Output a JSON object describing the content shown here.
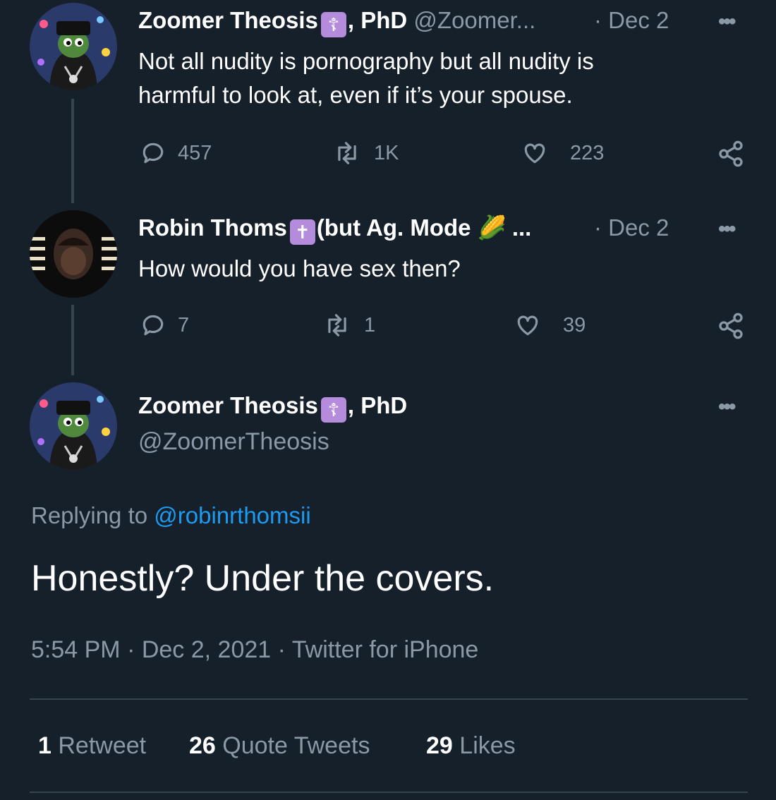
{
  "tweet1": {
    "name": "Zoomer Theosis",
    "badge": "☦",
    "name_suffix": ", PhD",
    "handle": "@Zoomer...",
    "date": "· Dec 2",
    "text_line1": "Not all nudity is pornography but all nudity is",
    "text_line2": "harmful to look at, even if it’s your spouse.",
    "replies": "457",
    "retweets": "1K",
    "likes": "223"
  },
  "tweet2": {
    "name": "Robin Thoms",
    "badge": "✝",
    "name_suffix": "(but Ag. Mode",
    "emoji": "🌽",
    "ellipsis": "...",
    "date": "· Dec 2",
    "text": "How would you have sex then?",
    "replies": "7",
    "retweets": "1",
    "likes": "39"
  },
  "main": {
    "name": "Zoomer Theosis",
    "badge": "☦",
    "name_suffix": ", PhD",
    "handle": "@ZoomerTheosis",
    "replying_prefix": "Replying to",
    "replying_handle": "@robinrthomsii",
    "text": "Honestly? Under the covers.",
    "meta": "5:54 PM · Dec 2, 2021 · Twitter for iPhone",
    "stats": {
      "retweets_num": "1",
      "retweets_label": "Retweet",
      "quotes_num": "26",
      "quotes_label": "Quote Tweets",
      "likes_num": "29",
      "likes_label": "Likes"
    }
  },
  "icons": {
    "more": "•••",
    "reply": "reply-icon",
    "retweet": "retweet-icon",
    "like": "heart-icon",
    "share": "share-icon"
  },
  "colors": {
    "background": "#15202b",
    "text": "#ffffff",
    "muted": "#8b98a5",
    "link": "#1d9bf0",
    "badge": "#b58bdc"
  }
}
